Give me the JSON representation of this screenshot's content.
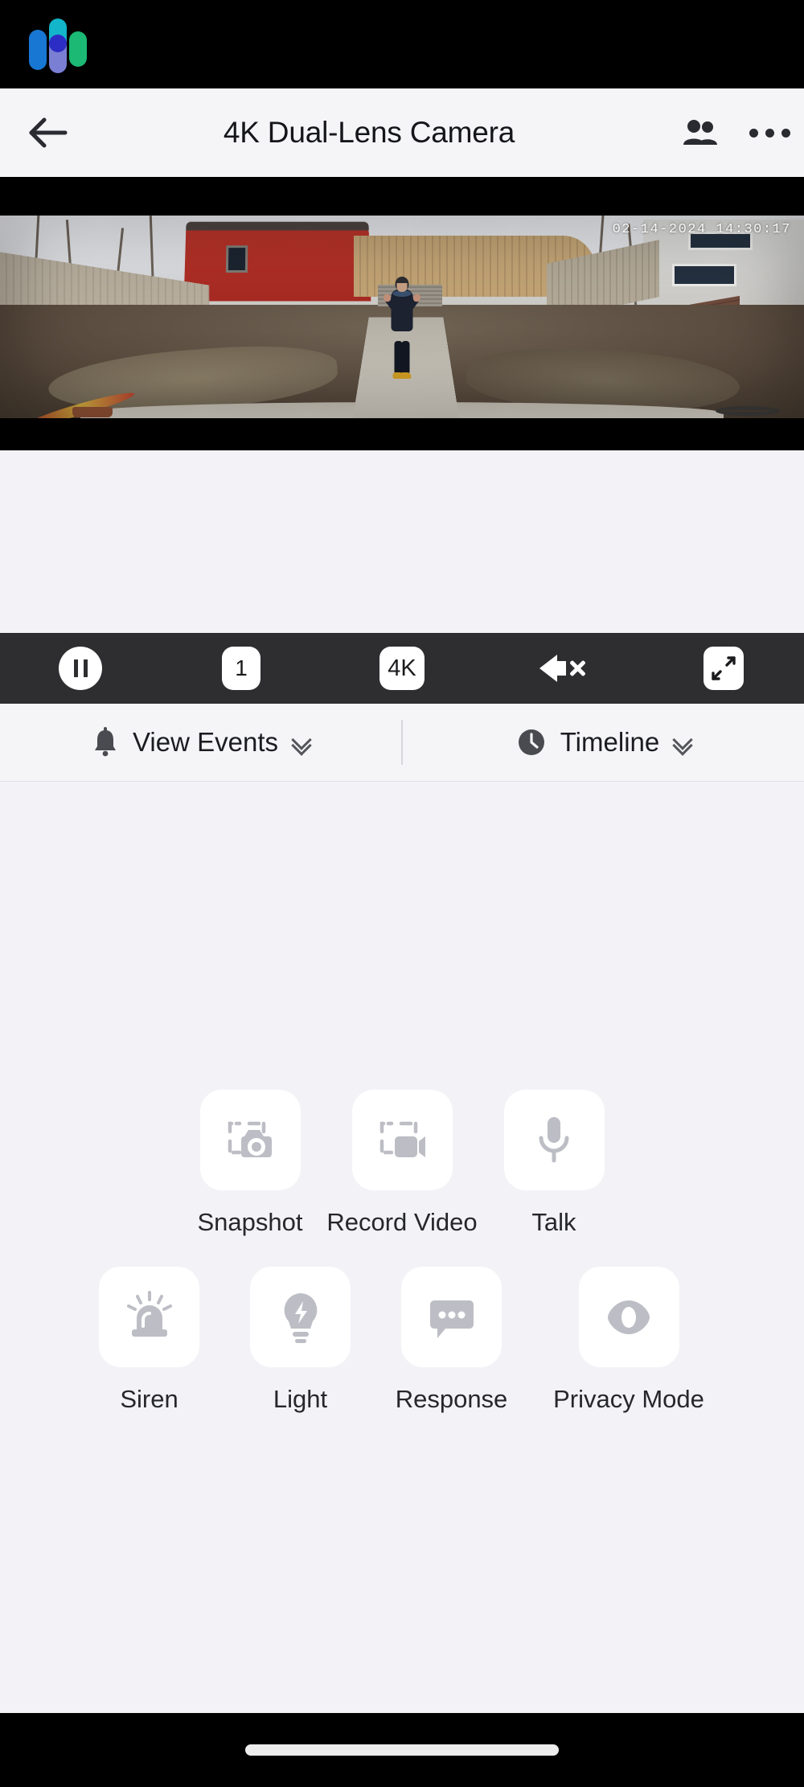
{
  "statusbar": {
    "logo_name": "app-logo"
  },
  "header": {
    "back_icon": "back-arrow-icon",
    "title": "4K Dual-Lens Camera",
    "people_icon": "people-icon",
    "menu_icon": "more-options-icon"
  },
  "video": {
    "timestamp": "02-14-2024 14:30:17",
    "scene_description": "Fisheye backyard camera view with person standing arms raised on walkway"
  },
  "controls": {
    "pause_label": "",
    "speed_label": "1",
    "quality_label": "4K",
    "mute_label": "",
    "fullscreen_label": ""
  },
  "tabs": [
    {
      "label": "View Events",
      "icon": "bell-icon"
    },
    {
      "label": "Timeline",
      "icon": "clock-icon"
    }
  ],
  "actions": {
    "row1": [
      {
        "label": "Snapshot",
        "icon": "snapshot-icon"
      },
      {
        "label": "Record Video",
        "icon": "record-video-icon"
      },
      {
        "label": "Talk",
        "icon": "microphone-icon"
      }
    ],
    "row2": [
      {
        "label": "Siren",
        "icon": "siren-icon"
      },
      {
        "label": "Light",
        "icon": "light-bulb-icon"
      },
      {
        "label": "Response",
        "icon": "response-bubble-icon"
      },
      {
        "label": "Privacy Mode",
        "icon": "eye-icon"
      }
    ]
  },
  "colors": {
    "background": "#F3F2F7",
    "header_bg": "#F5F5F8",
    "control_bar": "#2E2E30",
    "tile": "#FFFFFF",
    "icon_gray": "#BDBEC5",
    "text": "#26272C"
  }
}
